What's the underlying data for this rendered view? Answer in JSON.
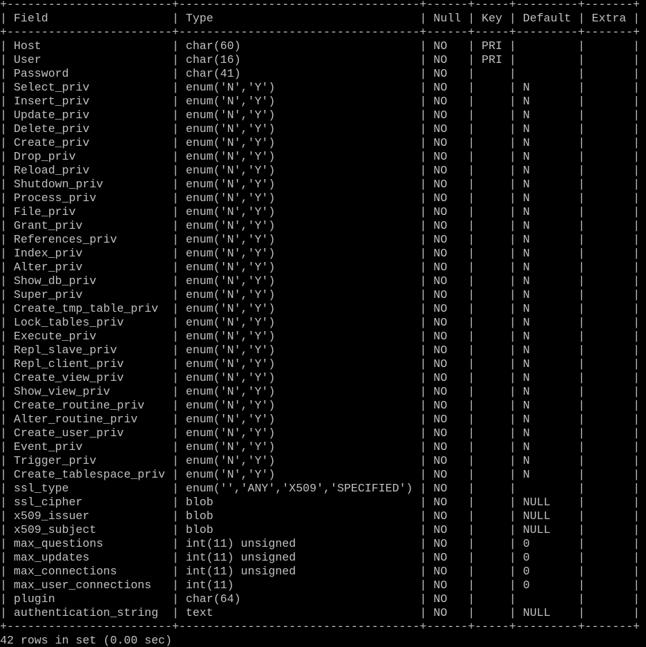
{
  "terminal": {
    "colors": {
      "background": "#000000",
      "foreground": "#c0c0c0"
    },
    "table": {
      "columns": [
        "Field",
        "Type",
        "Null",
        "Key",
        "Default",
        "Extra"
      ],
      "rows": [
        [
          "Host",
          "char(60)",
          "NO",
          "PRI",
          "",
          ""
        ],
        [
          "User",
          "char(16)",
          "NO",
          "PRI",
          "",
          ""
        ],
        [
          "Password",
          "char(41)",
          "NO",
          "",
          "",
          ""
        ],
        [
          "Select_priv",
          "enum('N','Y')",
          "NO",
          "",
          "N",
          ""
        ],
        [
          "Insert_priv",
          "enum('N','Y')",
          "NO",
          "",
          "N",
          ""
        ],
        [
          "Update_priv",
          "enum('N','Y')",
          "NO",
          "",
          "N",
          ""
        ],
        [
          "Delete_priv",
          "enum('N','Y')",
          "NO",
          "",
          "N",
          ""
        ],
        [
          "Create_priv",
          "enum('N','Y')",
          "NO",
          "",
          "N",
          ""
        ],
        [
          "Drop_priv",
          "enum('N','Y')",
          "NO",
          "",
          "N",
          ""
        ],
        [
          "Reload_priv",
          "enum('N','Y')",
          "NO",
          "",
          "N",
          ""
        ],
        [
          "Shutdown_priv",
          "enum('N','Y')",
          "NO",
          "",
          "N",
          ""
        ],
        [
          "Process_priv",
          "enum('N','Y')",
          "NO",
          "",
          "N",
          ""
        ],
        [
          "File_priv",
          "enum('N','Y')",
          "NO",
          "",
          "N",
          ""
        ],
        [
          "Grant_priv",
          "enum('N','Y')",
          "NO",
          "",
          "N",
          ""
        ],
        [
          "References_priv",
          "enum('N','Y')",
          "NO",
          "",
          "N",
          ""
        ],
        [
          "Index_priv",
          "enum('N','Y')",
          "NO",
          "",
          "N",
          ""
        ],
        [
          "Alter_priv",
          "enum('N','Y')",
          "NO",
          "",
          "N",
          ""
        ],
        [
          "Show_db_priv",
          "enum('N','Y')",
          "NO",
          "",
          "N",
          ""
        ],
        [
          "Super_priv",
          "enum('N','Y')",
          "NO",
          "",
          "N",
          ""
        ],
        [
          "Create_tmp_table_priv",
          "enum('N','Y')",
          "NO",
          "",
          "N",
          ""
        ],
        [
          "Lock_tables_priv",
          "enum('N','Y')",
          "NO",
          "",
          "N",
          ""
        ],
        [
          "Execute_priv",
          "enum('N','Y')",
          "NO",
          "",
          "N",
          ""
        ],
        [
          "Repl_slave_priv",
          "enum('N','Y')",
          "NO",
          "",
          "N",
          ""
        ],
        [
          "Repl_client_priv",
          "enum('N','Y')",
          "NO",
          "",
          "N",
          ""
        ],
        [
          "Create_view_priv",
          "enum('N','Y')",
          "NO",
          "",
          "N",
          ""
        ],
        [
          "Show_view_priv",
          "enum('N','Y')",
          "NO",
          "",
          "N",
          ""
        ],
        [
          "Create_routine_priv",
          "enum('N','Y')",
          "NO",
          "",
          "N",
          ""
        ],
        [
          "Alter_routine_priv",
          "enum('N','Y')",
          "NO",
          "",
          "N",
          ""
        ],
        [
          "Create_user_priv",
          "enum('N','Y')",
          "NO",
          "",
          "N",
          ""
        ],
        [
          "Event_priv",
          "enum('N','Y')",
          "NO",
          "",
          "N",
          ""
        ],
        [
          "Trigger_priv",
          "enum('N','Y')",
          "NO",
          "",
          "N",
          ""
        ],
        [
          "Create_tablespace_priv",
          "enum('N','Y')",
          "NO",
          "",
          "N",
          ""
        ],
        [
          "ssl_type",
          "enum('','ANY','X509','SPECIFIED')",
          "NO",
          "",
          "",
          ""
        ],
        [
          "ssl_cipher",
          "blob",
          "NO",
          "",
          "NULL",
          ""
        ],
        [
          "x509_issuer",
          "blob",
          "NO",
          "",
          "NULL",
          ""
        ],
        [
          "x509_subject",
          "blob",
          "NO",
          "",
          "NULL",
          ""
        ],
        [
          "max_questions",
          "int(11) unsigned",
          "NO",
          "",
          "0",
          ""
        ],
        [
          "max_updates",
          "int(11) unsigned",
          "NO",
          "",
          "0",
          ""
        ],
        [
          "max_connections",
          "int(11) unsigned",
          "NO",
          "",
          "0",
          ""
        ],
        [
          "max_user_connections",
          "int(11)",
          "NO",
          "",
          "0",
          ""
        ],
        [
          "plugin",
          "char(64)",
          "NO",
          "",
          "",
          ""
        ],
        [
          "authentication_string",
          "text",
          "NO",
          "",
          "NULL",
          ""
        ]
      ]
    },
    "status_line": "42 rows in set (0.00 sec)"
  }
}
